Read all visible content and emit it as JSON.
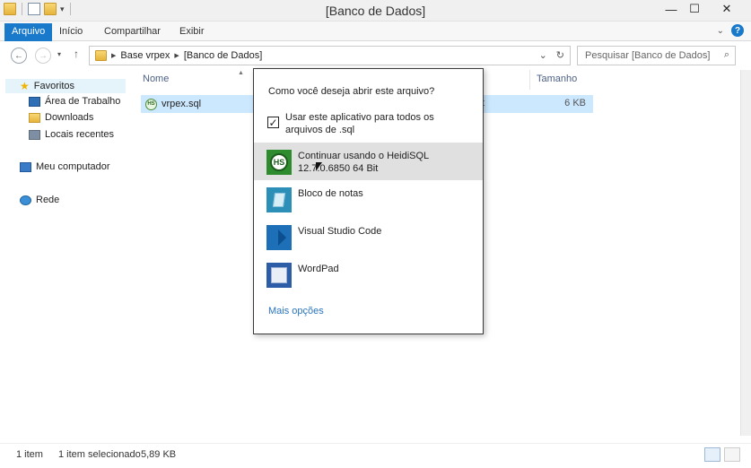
{
  "window": {
    "title": "[Banco de Dados]",
    "controls": [
      "—",
      "☐",
      "✕"
    ]
  },
  "ribbon": {
    "tabs": [
      "Arquivo",
      "Início",
      "Compartilhar",
      "Exibir"
    ],
    "help_label": "?"
  },
  "address": {
    "path": [
      "Base vrpex",
      "[Banco de Dados]"
    ],
    "search_placeholder": "Pesquisar [Banco de Dados]"
  },
  "navpane": {
    "favorites": "Favoritos",
    "items": [
      "Área de Trabalho",
      "Downloads",
      "Locais recentes"
    ],
    "computer": "Meu computador",
    "network": "Rede"
  },
  "filelist": {
    "col_name": "Nome",
    "col_size": "Tamanho",
    "files": [
      {
        "name": "vrpex.sql",
        "type_fragment": "t",
        "size": "6 KB"
      }
    ]
  },
  "status": {
    "count": "1 item",
    "selected": "1 item selecionado",
    "selected_size": "5,89 KB"
  },
  "dialog": {
    "question": "Como você deseja abrir este arquivo?",
    "checkbox_label": "Usar este aplicativo para todos os arquivos de .sql",
    "checkbox_checked": true,
    "apps": [
      {
        "name": "Continuar usando o HeidiSQL",
        "sub": "12.7.0.6850 64 Bit",
        "icon": "heidisql-icon",
        "glyph": "HS"
      },
      {
        "name": "Bloco de notas",
        "sub": "",
        "icon": "notepad-icon"
      },
      {
        "name": "Visual Studio Code",
        "sub": "",
        "icon": "vscode-icon"
      },
      {
        "name": "WordPad",
        "sub": "",
        "icon": "wordpad-icon"
      }
    ],
    "more_link": "Mais opções"
  }
}
